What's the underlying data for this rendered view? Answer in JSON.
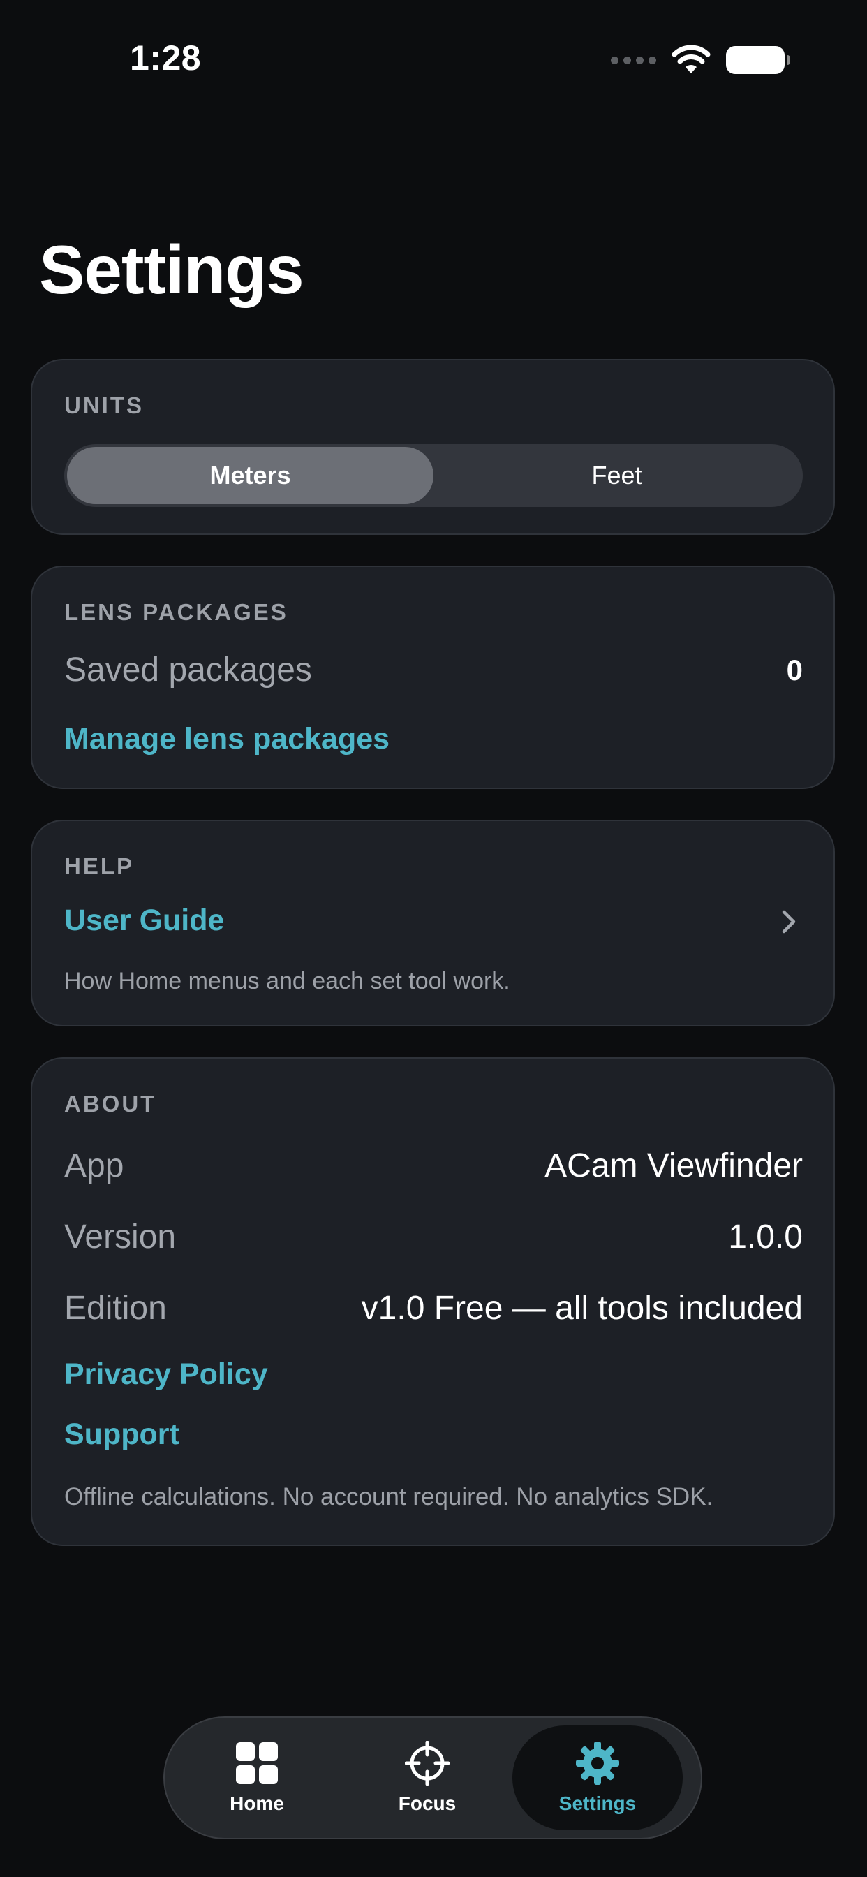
{
  "status_bar": {
    "time": "1:28"
  },
  "page_title": "Settings",
  "units": {
    "header": "UNITS",
    "options": [
      "Meters",
      "Feet"
    ],
    "selected": "Meters"
  },
  "lens_packages": {
    "header": "LENS PACKAGES",
    "saved_label": "Saved packages",
    "saved_count": "0",
    "manage_link": "Manage lens packages"
  },
  "help": {
    "header": "HELP",
    "user_guide_link": "User Guide",
    "description": "How Home menus and each set tool work."
  },
  "about": {
    "header": "ABOUT",
    "rows": [
      {
        "label": "App",
        "value": "ACam Viewfinder"
      },
      {
        "label": "Version",
        "value": "1.0.0"
      },
      {
        "label": "Edition",
        "value": "v1.0 Free — all tools included"
      }
    ],
    "privacy_link": "Privacy Policy",
    "support_link": "Support",
    "note": "Offline calculations. No account required. No analytics SDK."
  },
  "tabbar": {
    "tabs": [
      {
        "label": "Home",
        "icon": "grid-icon"
      },
      {
        "label": "Focus",
        "icon": "crosshair-icon"
      },
      {
        "label": "Settings",
        "icon": "gear-icon"
      }
    ],
    "selected": "Settings"
  },
  "colors": {
    "accent": "#4eb6c8",
    "background": "#0c0d0f",
    "card": "#1d2026"
  }
}
